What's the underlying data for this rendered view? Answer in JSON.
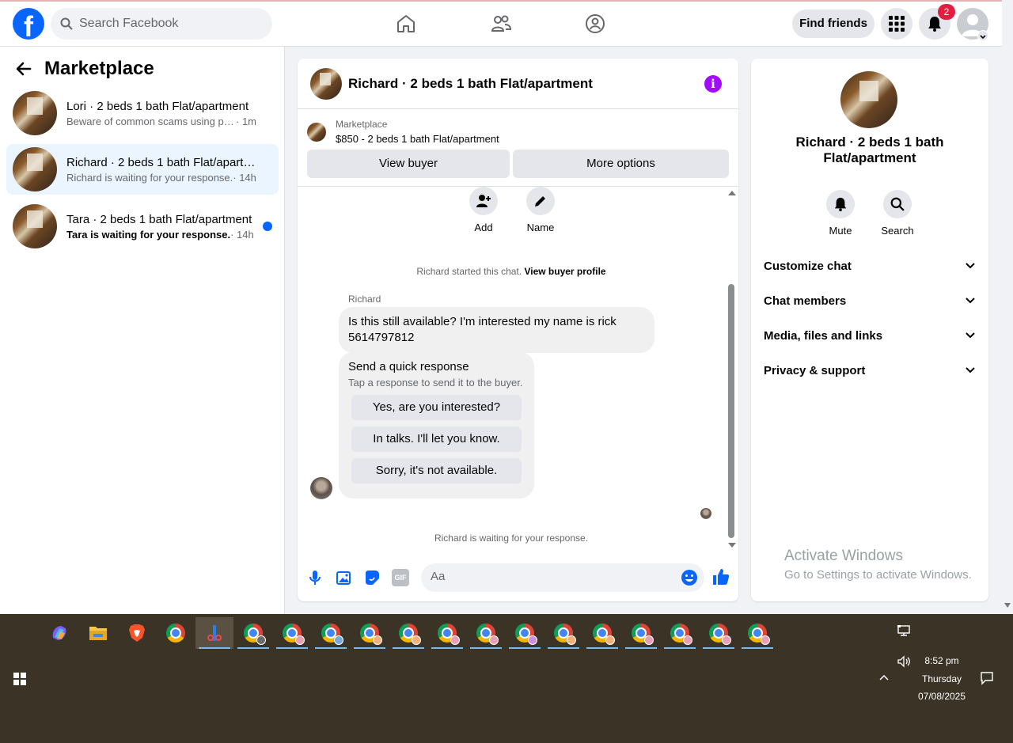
{
  "topbar": {
    "logo_letter": "f",
    "search_placeholder": "Search Facebook",
    "find_friends": "Find friends",
    "notification_count": "2"
  },
  "sidebar": {
    "title": "Marketplace",
    "conversations": [
      {
        "title": "Lori · 2 beds 1 bath Flat/apartment",
        "snippet": "Beware of common scams using pay...",
        "time": "· 1m",
        "unread": false,
        "active": false
      },
      {
        "title": "Richard · 2 beds 1 bath Flat/apartment",
        "snippet": "Richard is waiting for your response.",
        "time": "· 14h",
        "unread": false,
        "active": true
      },
      {
        "title": "Tara · 2 beds 1 bath Flat/apartment",
        "snippet": "Tara is waiting for your response.",
        "time": "· 14h",
        "unread": true,
        "active": false
      }
    ]
  },
  "chat": {
    "title": "Richard · 2 beds 1 bath Flat/apartment",
    "listing_source": "Marketplace",
    "listing_price": "$850 - 2 beds 1 bath Flat/apartment",
    "view_buyer": "View buyer",
    "more_options": "More options",
    "add_label": "Add",
    "name_label": "Name",
    "started_text": "Richard started this chat.",
    "view_profile": "View buyer profile",
    "sender": "Richard",
    "message_line1": "Is this still available? I'm interested my name is rick",
    "message_line2": "5614797812",
    "quick_title": "Send a quick response",
    "quick_sub": "Tap a response to send it to the buyer.",
    "quick_responses": [
      "Yes, are you interested?",
      "In talks. I'll let you know.",
      "Sorry, it's not available."
    ],
    "waiting_text": "Richard is waiting for your response.",
    "composer_placeholder": "Aa",
    "gif_label": "GIF"
  },
  "details": {
    "title": "Richard · 2 beds 1 bath Flat/apartment",
    "mute": "Mute",
    "search": "Search",
    "sections": [
      "Customize chat",
      "Chat members",
      "Media, files and links",
      "Privacy & support"
    ]
  },
  "watermark": {
    "line1": "Activate Windows",
    "line2": "Go to Settings to activate Windows."
  },
  "taskbar": {
    "time": "8:52 pm",
    "day": "Thursday",
    "date": "07/08/2025"
  },
  "colors": {
    "facebook_blue": "#0866ff",
    "info_purple": "#a20bff",
    "unread_blue": "#0866ff",
    "badge_red": "#e41e3f"
  }
}
